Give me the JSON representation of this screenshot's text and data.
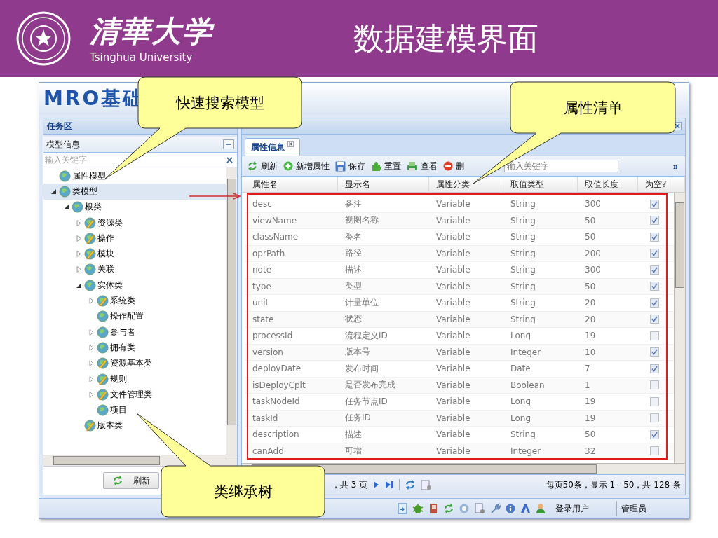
{
  "slide": {
    "logo_text": "清華大学",
    "logo_subtitle": "Tsinghua University",
    "title": "数据建模界面"
  },
  "app": {
    "banner": "MRO基础",
    "left_panel": {
      "title": "任务区",
      "section": "模型信息",
      "search": {
        "placeholder": "输入关键字"
      },
      "tree": [
        {
          "label": "属性模型",
          "kind": "globe",
          "expandable": false,
          "expanded": false,
          "selected": false
        },
        {
          "label": "类模型",
          "kind": "globe",
          "expandable": true,
          "expanded": true,
          "selected": true,
          "children": [
            {
              "label": "根类",
              "kind": "globe",
              "expandable": true,
              "expanded": true,
              "selected": false,
              "children": [
                {
                  "label": "资源类",
                  "kind": "edit",
                  "expandable": true,
                  "expanded": false,
                  "selected": false
                },
                {
                  "label": "操作",
                  "kind": "edit",
                  "expandable": true,
                  "expanded": false,
                  "selected": false
                },
                {
                  "label": "模块",
                  "kind": "edit",
                  "expandable": true,
                  "expanded": false,
                  "selected": false
                },
                {
                  "label": "关联",
                  "kind": "globe",
                  "expandable": true,
                  "expanded": false,
                  "selected": false
                },
                {
                  "label": "实体类",
                  "kind": "globe",
                  "expandable": true,
                  "expanded": true,
                  "selected": false,
                  "children": [
                    {
                      "label": "系统类",
                      "kind": "edit",
                      "expandable": true,
                      "expanded": false,
                      "selected": false
                    },
                    {
                      "label": "操作配置",
                      "kind": "globe",
                      "expandable": false,
                      "expanded": false,
                      "selected": false
                    },
                    {
                      "label": "参与者",
                      "kind": "globe",
                      "expandable": true,
                      "expanded": false,
                      "selected": false
                    },
                    {
                      "label": "拥有类",
                      "kind": "globe",
                      "expandable": true,
                      "expanded": false,
                      "selected": false
                    },
                    {
                      "label": "资源基本类",
                      "kind": "edit",
                      "expandable": true,
                      "expanded": false,
                      "selected": false
                    },
                    {
                      "label": "规则",
                      "kind": "edit",
                      "expandable": true,
                      "expanded": false,
                      "selected": false
                    },
                    {
                      "label": "文件管理类",
                      "kind": "edit",
                      "expandable": true,
                      "expanded": false,
                      "selected": false
                    },
                    {
                      "label": "项目",
                      "kind": "globe",
                      "expandable": false,
                      "expanded": false,
                      "selected": false
                    }
                  ]
                },
                {
                  "label": "版本类",
                  "kind": "edit",
                  "expandable": false,
                  "expanded": false,
                  "selected": false
                }
              ]
            }
          ]
        }
      ],
      "refresh_button": "刷新"
    },
    "right_panel": {
      "tabs": [
        {
          "label": "属性信息",
          "selected": true
        }
      ],
      "toolbar": [
        {
          "kind": "refresh",
          "label": "刷新"
        },
        {
          "kind": "add",
          "label": "新增属性"
        },
        {
          "kind": "save",
          "label": "保存"
        },
        {
          "kind": "reset",
          "label": "重置"
        },
        {
          "kind": "view",
          "label": "查看"
        },
        {
          "kind": "delete",
          "label": "删"
        }
      ],
      "search": {
        "placeholder": "输入关键字"
      },
      "more": "»",
      "table": {
        "columns": [
          "属性名",
          "显示名",
          "属性分类",
          "取值类型",
          "取值长度",
          "为空?"
        ],
        "rows": [
          {
            "cells": [
              "desc",
              "备注",
              "Variable",
              "String",
              "300"
            ],
            "checked": true
          },
          {
            "cells": [
              "viewName",
              "视图名称",
              "Variable",
              "String",
              "50"
            ],
            "checked": true
          },
          {
            "cells": [
              "className",
              "类名",
              "Variable",
              "String",
              "50"
            ],
            "checked": true
          },
          {
            "cells": [
              "oprPath",
              "路径",
              "Variable",
              "String",
              "200"
            ],
            "checked": true
          },
          {
            "cells": [
              "note",
              "描述",
              "Variable",
              "String",
              "300"
            ],
            "checked": true
          },
          {
            "cells": [
              "type",
              "类型",
              "Variable",
              "String",
              "50"
            ],
            "checked": true
          },
          {
            "cells": [
              "unit",
              "计量单位",
              "Variable",
              "String",
              "20"
            ],
            "checked": true
          },
          {
            "cells": [
              "state",
              "状态",
              "Variable",
              "String",
              "20"
            ],
            "checked": true
          },
          {
            "cells": [
              "processId",
              "流程定义ID",
              "Variable",
              "Long",
              "19"
            ],
            "checked": false
          },
          {
            "cells": [
              "version",
              "版本号",
              "Variable",
              "Integer",
              "10"
            ],
            "checked": true
          },
          {
            "cells": [
              "deployDate",
              "发布时间",
              "Variable",
              "Date",
              "7"
            ],
            "checked": true
          },
          {
            "cells": [
              "isDeployCplt",
              "是否发布完成",
              "Variable",
              "Boolean",
              "1"
            ],
            "checked": false
          },
          {
            "cells": [
              "taskNodeId",
              "任务节点ID",
              "Variable",
              "Long",
              "19"
            ],
            "checked": false
          },
          {
            "cells": [
              "taskId",
              "任务ID",
              "Variable",
              "Long",
              "19"
            ],
            "checked": false
          },
          {
            "cells": [
              "description",
              "描述",
              "Variable",
              "String",
              "50"
            ],
            "checked": true
          },
          {
            "cells": [
              "canAdd",
              "可增",
              "Variable",
              "Integer",
              "32"
            ],
            "checked": false
          }
        ]
      },
      "paging": {
        "pages": "，共 3 页",
        "summary": "每页50条，显示 1 - 50，共 128 条"
      }
    },
    "status_bar": {
      "user_label": "登录用户",
      "user": "管理员"
    }
  },
  "callouts": [
    {
      "text": "快速搜索模型"
    },
    {
      "text": "属性清单"
    },
    {
      "text": "类继承树"
    }
  ]
}
